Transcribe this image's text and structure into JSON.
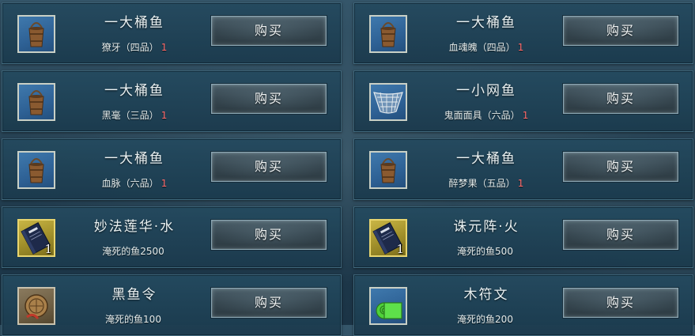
{
  "shop": {
    "buy_label": "购买",
    "items": [
      {
        "name": "一大桶鱼",
        "cost_name": "獠牙（四品）",
        "cost_count": "1",
        "icon": "bucket-icon",
        "qty": ""
      },
      {
        "name": "一大桶鱼",
        "cost_name": "血魂魄（四品）",
        "cost_count": "1",
        "icon": "bucket-icon",
        "qty": ""
      },
      {
        "name": "一大桶鱼",
        "cost_name": "黑毫（三品）",
        "cost_count": "1",
        "icon": "bucket-icon",
        "qty": ""
      },
      {
        "name": "一小网鱼",
        "cost_name": "鬼面面具（六品）",
        "cost_count": "1",
        "icon": "fishing-net-icon",
        "qty": ""
      },
      {
        "name": "一大桶鱼",
        "cost_name": "血脉（六品）",
        "cost_count": "1",
        "icon": "bucket-icon",
        "qty": ""
      },
      {
        "name": "一大桶鱼",
        "cost_name": "醉梦果（五品）",
        "cost_count": "1",
        "icon": "bucket-icon",
        "qty": ""
      },
      {
        "name": "妙法莲华·水",
        "cost_name": "淹死的鱼2500",
        "cost_count": "",
        "icon": "book-icon",
        "qty": "1"
      },
      {
        "name": "诛元阵·火",
        "cost_name": "淹死的鱼500",
        "cost_count": "",
        "icon": "book-icon",
        "qty": "1"
      },
      {
        "name": "黑鱼令",
        "cost_name": "淹死的鱼100",
        "cost_count": "",
        "icon": "bronze-token-icon",
        "qty": ""
      },
      {
        "name": "木符文",
        "cost_name": "淹死的鱼200",
        "cost_count": "",
        "icon": "green-scroll-icon",
        "qty": ""
      }
    ]
  }
}
